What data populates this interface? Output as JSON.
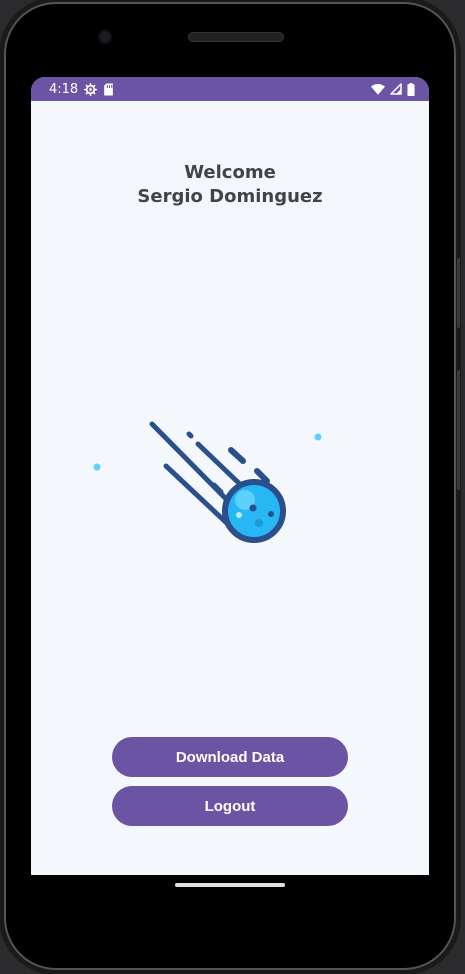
{
  "status_bar": {
    "time": "4:18",
    "left_icons": [
      "settings-gear-icon",
      "sd-card-icon"
    ],
    "right_icons": [
      "wifi-icon",
      "signal-icon",
      "battery-icon"
    ],
    "color": "#6b54a4"
  },
  "welcome": {
    "line1": "Welcome",
    "line2": "Sergio Dominguez"
  },
  "illustration": "comet-icon",
  "buttons": {
    "download_label": "Download Data",
    "logout_label": "Logout"
  },
  "colors": {
    "accent": "#6b54a4",
    "background": "#f4f8fc",
    "text": "#44434d",
    "comet_blue": "#27b7f5",
    "comet_outline": "#2b4e8c"
  }
}
